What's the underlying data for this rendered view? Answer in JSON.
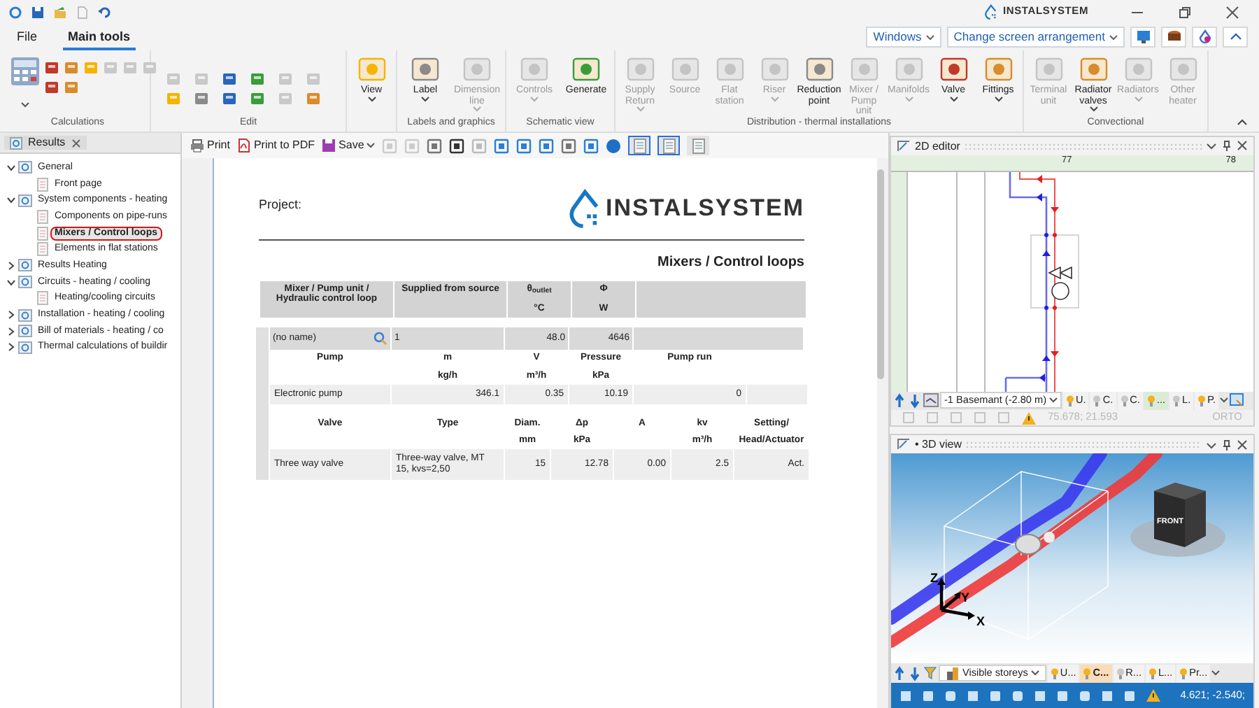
{
  "title_bar": {
    "logo": "INSTALSYSTEM"
  },
  "menu_tabs": [
    {
      "label": "File",
      "selected": false
    },
    {
      "label": "Main tools",
      "selected": true
    }
  ],
  "window_menus": [
    {
      "label": "Windows"
    },
    {
      "label": "Change screen arrangement"
    }
  ],
  "ribbon_groups": [
    {
      "kind": "calc",
      "label": "Calculations"
    },
    {
      "kind": "edit",
      "label": "Edit"
    },
    {
      "kind": "buttons",
      "buttons": [
        {
          "label": "View",
          "disabled": false,
          "dropdown": true
        }
      ]
    },
    {
      "kind": "buttons",
      "label": "Labels and graphics",
      "buttons": [
        {
          "label": "Label",
          "disabled": false,
          "dropdown": true
        },
        {
          "label": "Dimension line",
          "disabled": true,
          "dropdown": true
        }
      ]
    },
    {
      "kind": "buttons",
      "label": "Schematic view",
      "buttons": [
        {
          "label": "Controls",
          "disabled": true,
          "dropdown": true
        },
        {
          "label": "Generate",
          "disabled": false,
          "dropdown": false
        }
      ]
    },
    {
      "kind": "buttons",
      "label": "Distribution - thermal installations",
      "buttons": [
        {
          "label": "Supply Return",
          "disabled": true,
          "dropdown": true
        },
        {
          "label": "Source",
          "disabled": true,
          "dropdown": false
        },
        {
          "label": "Flat station",
          "disabled": true,
          "dropdown": false
        },
        {
          "label": "Riser",
          "disabled": true,
          "dropdown": true
        },
        {
          "label": "Reduction point",
          "disabled": false,
          "dropdown": false
        },
        {
          "label": "Mixer / Pump unit",
          "disabled": true,
          "dropdown": false
        },
        {
          "label": "Manifolds",
          "disabled": true,
          "dropdown": true
        },
        {
          "label": "Valve",
          "disabled": false,
          "dropdown": true
        },
        {
          "label": "Fittings",
          "disabled": false,
          "dropdown": true
        }
      ]
    },
    {
      "kind": "buttons",
      "label": "Convectional",
      "buttons": [
        {
          "label": "Terminal unit",
          "disabled": true,
          "dropdown": false
        },
        {
          "label": "Radiator valves",
          "disabled": false,
          "dropdown": true
        },
        {
          "label": "Radiators",
          "disabled": true,
          "dropdown": true
        },
        {
          "label": "Other heater",
          "disabled": true,
          "dropdown": false
        }
      ]
    }
  ],
  "results_panel": {
    "tab": "Results",
    "tree": [
      {
        "label": "General",
        "expanded": true,
        "selected": false,
        "children": [
          {
            "label": "Front page",
            "selected": false
          }
        ]
      },
      {
        "label": "System components - heating",
        "expanded": true,
        "selected": false,
        "children": [
          {
            "label": "Components on pipe-runs",
            "selected": false
          },
          {
            "label": "Mixers / Control loops",
            "selected": true
          },
          {
            "label": "Elements in flat stations",
            "selected": false
          }
        ]
      },
      {
        "label": "Results Heating",
        "expanded": false,
        "selected": false
      },
      {
        "label": "Circuits - heating / cooling",
        "expanded": true,
        "selected": false,
        "children": [
          {
            "label": "Heating/cooling circuits",
            "selected": false
          }
        ]
      },
      {
        "label": "Installation - heating / cooling",
        "expanded": false,
        "selected": false
      },
      {
        "label": "Bill of materials - heating / co",
        "expanded": false,
        "selected": false
      },
      {
        "label": "Thermal calculations of buildir",
        "expanded": false,
        "selected": false
      }
    ]
  },
  "report_toolbar": {
    "buttons": [
      {
        "label": "Print",
        "dropdown": false
      },
      {
        "label": "Print to PDF",
        "dropdown": false
      },
      {
        "label": "Save",
        "dropdown": true
      }
    ],
    "view_toggles": [
      {
        "selected": true
      },
      {
        "selected": true
      },
      {
        "selected": false
      }
    ]
  },
  "report": {
    "project_label": "Project:",
    "logo": "INSTALSYSTEM",
    "title": "Mixers / Control loops",
    "columns": [
      {
        "name": "Mixer / Pump unit / Hydraulic control loop"
      },
      {
        "name": "Supplied from source"
      },
      {
        "name": "θ$_{outlet}$",
        "unit": "°C"
      },
      {
        "name": "Φ",
        "unit": "W"
      }
    ],
    "groups": [
      {
        "name": "(no name)",
        "source": "1",
        "outlet_temp": "48.0",
        "heat_flow": "4646",
        "pump_table": {
          "columns": [
            {
              "name": "Pump"
            },
            {
              "name": "m",
              "unit": "kg/h"
            },
            {
              "name": "V",
              "unit": "m³/h"
            },
            {
              "name": "Pressure",
              "unit": "kPa"
            },
            {
              "name": "Pump run"
            }
          ],
          "rows": [
            [
              "Electronic pump",
              "346.1",
              "0.35",
              "10.19",
              "0"
            ]
          ]
        },
        "valve_table": {
          "columns": [
            {
              "name": "Valve"
            },
            {
              "name": "Type"
            },
            {
              "name": "Diam.",
              "unit": "mm"
            },
            {
              "name": "Δp",
              "unit": "kPa"
            },
            {
              "name": "A"
            },
            {
              "name": "kv",
              "unit": "m³/h"
            },
            {
              "name": "Setting/",
              "unit": "Head/Actuator"
            }
          ],
          "rows": [
            [
              "Three way valve",
              "Three-way valve, MT 15, kvs=2,50",
              "15",
              "12.78",
              "0.00",
              "2.5",
              "Act."
            ]
          ]
        }
      }
    ]
  },
  "editor_2d": {
    "title": "2D editor",
    "ruler_labels": [
      "77",
      "78"
    ],
    "storey": "-1 Basemant (-2.80 m)",
    "layer_tabs": [
      {
        "label": "U.",
        "on": true,
        "selected": false
      },
      {
        "label": "C.",
        "on": false,
        "selected": false
      },
      {
        "label": "C.",
        "on": false,
        "selected": false
      },
      {
        "label": "...",
        "on": true,
        "selected": true
      },
      {
        "label": "L.",
        "on": false,
        "selected": false
      },
      {
        "label": "P.",
        "on": true,
        "selected": false
      }
    ],
    "coords": "75.678; 21.593",
    "mode": "ORTO"
  },
  "view_3d": {
    "title": "• 3D view",
    "axes": [
      "Z",
      "Y",
      "X"
    ],
    "cube_face": "FRONT",
    "storeys_button": "Visible storeys",
    "layer_tabs": [
      {
        "label": "U...",
        "on": true,
        "selected": false
      },
      {
        "label": "C...",
        "on": true,
        "selected": true
      },
      {
        "label": "R...",
        "on": false,
        "selected": false
      },
      {
        "label": "L...",
        "on": true,
        "selected": false
      },
      {
        "label": "Pr...",
        "on": true,
        "selected": false
      }
    ],
    "coords": "4.621; -2.540;"
  }
}
